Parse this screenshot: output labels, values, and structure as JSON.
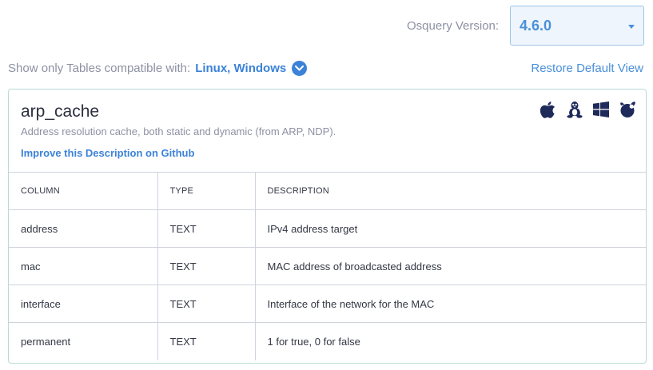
{
  "version": {
    "label": "Osquery Version:",
    "selected": "4.6.0"
  },
  "filter": {
    "label": "Show only Tables compatible with:",
    "value": "Linux, Windows"
  },
  "restore_link": "Restore Default View",
  "table_card": {
    "name": "arp_cache",
    "description": "Address resolution cache, both static and dynamic (from ARP, NDP).",
    "improve_link": "Improve this Description on Github",
    "platform_icons": [
      "apple-icon",
      "linux-icon",
      "windows-icon",
      "freebsd-icon"
    ],
    "columns_header": [
      "COLUMN",
      "TYPE",
      "DESCRIPTION"
    ],
    "rows": [
      [
        "address",
        "TEXT",
        "IPv4 address target"
      ],
      [
        "mac",
        "TEXT",
        "MAC address of broadcasted address"
      ],
      [
        "interface",
        "TEXT",
        "Interface of the network for the MAC"
      ],
      [
        "permanent",
        "TEXT",
        "1 for true, 0 for false"
      ]
    ]
  },
  "colors": {
    "accent": "#3b82d8",
    "icon": "#1e2a5a",
    "card_border": "#b7dcd4"
  }
}
